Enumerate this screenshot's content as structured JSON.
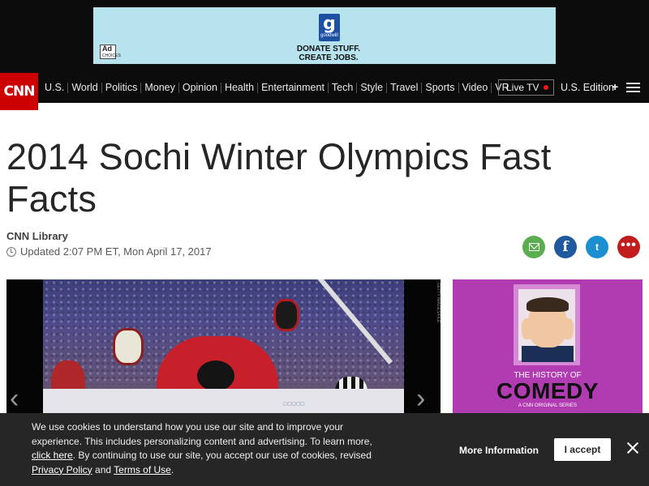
{
  "ad": {
    "choices_label": "Ad",
    "choices_sub": "CHOICES",
    "brand_glyph": "g",
    "brand_name": "goodwill",
    "line1": "DONATE STUFF.",
    "line2": "CREATE JOBS."
  },
  "nav": {
    "logo": "CNN",
    "links": [
      "U.S.",
      "World",
      "Politics",
      "Money",
      "Opinion",
      "Health",
      "Entertainment",
      "Tech",
      "Style",
      "Travel",
      "Sports",
      "Video",
      "VR"
    ],
    "live_label": "Live TV",
    "edition_label": "U.S. Edition",
    "edition_plus": "+"
  },
  "article": {
    "headline": "2014 Sochi Winter Olympics Fast Facts",
    "byline": "CNN Library",
    "updated": "Updated 2:07 PM ET, Mon April 17, 2017"
  },
  "share": {
    "facebook_glyph": "f",
    "twitter_glyph": "t",
    "more_glyph": "•••"
  },
  "gallery": {
    "prev_glyph": "‹",
    "next_glyph": "›",
    "credit": "GETTY IMAGES/FILE"
  },
  "side_ad": {
    "title": "THE HISTORY OF",
    "big": "COMEDY",
    "sub": "A CNN ORIGINAL SERIES"
  },
  "cookie": {
    "text_1": "We use cookies to understand how you use our site and to improve your experience. This includes personalizing content and advertising. To learn more, ",
    "link_1": "click here",
    "text_2": ". By continuing to use our site, you accept our use of cookies, revised ",
    "link_2": "Privacy Policy",
    "text_3": " and ",
    "link_3": "Terms of Use",
    "text_4": ".",
    "more_info": "More Information",
    "accept": "I accept"
  },
  "colors": {
    "cnn_red": "#cc0000",
    "nav_bg": "#0c0c0c",
    "ad_bg": "#b6e3ee",
    "email_green": "#5aae50",
    "facebook_blue": "#1f5a9f",
    "twitter_blue": "#1c8fd1",
    "more_red": "#c11d1d",
    "side_ad_purple": "#b13bb1",
    "cookie_bg": "#262626"
  }
}
